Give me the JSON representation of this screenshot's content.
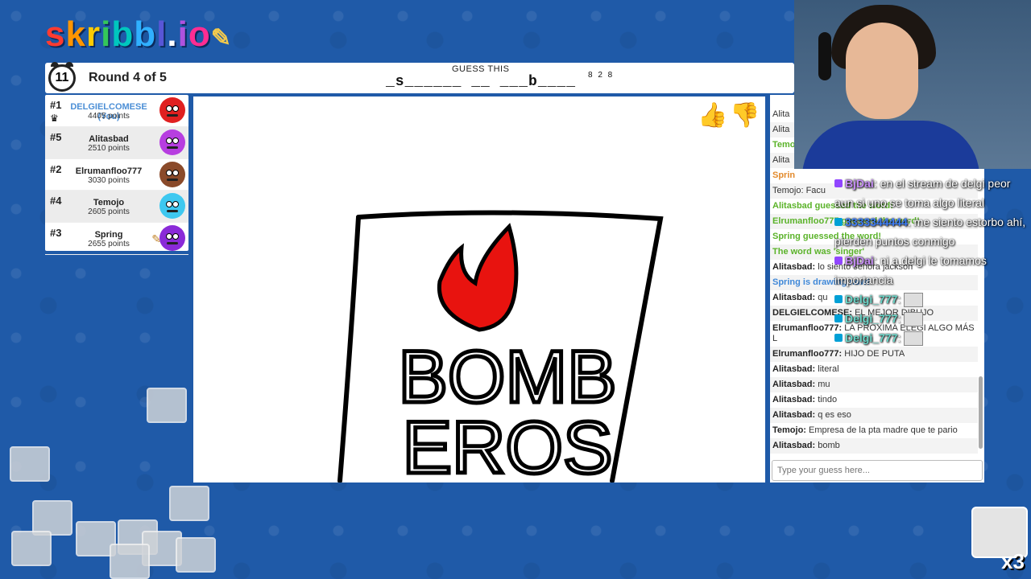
{
  "logo": {
    "letters": [
      "s",
      "k",
      "r",
      "i",
      "b",
      "b",
      "l",
      ".",
      "i",
      "o"
    ],
    "colors": [
      "#ff3b30",
      "#ff9500",
      "#ffcc00",
      "#34c759",
      "#00c7be",
      "#30b0ff",
      "#5856d6",
      "#ffffff",
      "#af52de",
      "#ff2d92"
    ]
  },
  "header": {
    "timer": "11",
    "round": "Round 4 of 5",
    "guess_title": "GUESS THIS",
    "word_hint": "_s______ __ ___b____",
    "word_lengths": "8 2 8"
  },
  "players": [
    {
      "rank": "#1",
      "name": "DELGIELCOMESE (You)",
      "points": "4405 points",
      "avatar_color": "#e02020",
      "you": true,
      "crown": true
    },
    {
      "rank": "#5",
      "name": "Alitasbad",
      "points": "2510 points",
      "avatar_color": "#b73ee0"
    },
    {
      "rank": "#2",
      "name": "Elrumanfloo777",
      "points": "3030 points",
      "avatar_color": "#8a4a2a"
    },
    {
      "rank": "#4",
      "name": "Temojo",
      "points": "2605 points",
      "avatar_color": "#3ec8f0"
    },
    {
      "rank": "#3",
      "name": "Spring",
      "points": "2655 points",
      "avatar_color": "#8a2ad8",
      "drawing": true
    }
  ],
  "drawing": {
    "word_top": "BOMB",
    "word_bottom": "EROS"
  },
  "chat": {
    "messages": [
      {
        "text": "Alita",
        "style": "normal"
      },
      {
        "text": "Alita",
        "style": "normal"
      },
      {
        "text": "Temo",
        "style": "green"
      },
      {
        "text": "Alita",
        "style": "normal"
      },
      {
        "text": "Sprin",
        "style": "orange"
      },
      {
        "text": "Temojo: Facu",
        "style": "normal"
      },
      {
        "text": "Alitasbad guessed the word!",
        "style": "green"
      },
      {
        "text": "Elrumanfloo777 guessed the word!",
        "style": "green"
      },
      {
        "text": "Spring guessed the word!",
        "style": "green"
      },
      {
        "text": "The word was 'singer'",
        "style": "green"
      },
      {
        "user": "Alitasbad:",
        "text": "lo siento señora jackson",
        "style": "normal"
      },
      {
        "text": "Spring is drawing now!",
        "style": "blue"
      },
      {
        "user": "Alitasbad:",
        "text": "qu",
        "style": "normal"
      },
      {
        "user": "DELGIELCOMESE:",
        "text": "EL MEJOR DIBUJO",
        "style": "normal"
      },
      {
        "user": "Elrumanfloo777:",
        "text": "LA PROXIMA ELEGI ALGO MÁS L",
        "style": "normal"
      },
      {
        "user": "Elrumanfloo777:",
        "text": "HIJO DE PUTA",
        "style": "normal"
      },
      {
        "user": "Alitasbad:",
        "text": "literal",
        "style": "normal"
      },
      {
        "user": "Alitasbad:",
        "text": "mu",
        "style": "normal"
      },
      {
        "user": "Alitasbad:",
        "text": "tindo",
        "style": "normal"
      },
      {
        "user": "Alitasbad:",
        "text": "q es eso",
        "style": "normal"
      },
      {
        "user": "Temojo:",
        "text": "Empresa de la pta madre que te pario",
        "style": "normal"
      },
      {
        "user": "Alitasbad:",
        "text": "bomb",
        "style": "normal"
      }
    ],
    "input_placeholder": "Type your guess here..."
  },
  "twitch_chat": [
    {
      "user": "BjDai",
      "color": "purple",
      "text": ": en el stream de delgi peor aun si uno se toma algo literal"
    },
    {
      "user": "3333344444",
      "color": "blue",
      "text": ": me siento estorbo ahí, pierden puntos conmigo"
    },
    {
      "user": "BjDai",
      "color": "purple",
      "text": ": ni a delgi le tomamos importancia"
    },
    {
      "user": "Delgi_777",
      "color": "teal",
      "text": ":"
    },
    {
      "user": "Delgi_777",
      "color": "teal",
      "text": ":"
    },
    {
      "user": "Delgi_777",
      "color": "teal",
      "text": ":"
    }
  ],
  "emote_counter": "x3"
}
